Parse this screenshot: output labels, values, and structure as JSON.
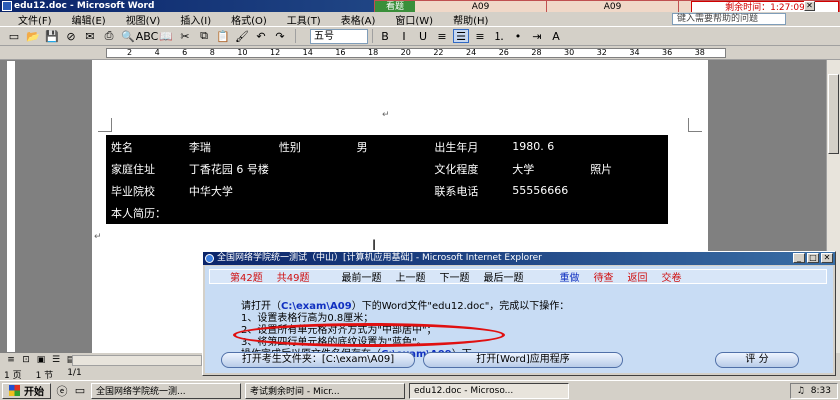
{
  "window": {
    "title": "edu12.doc - Microsoft Word",
    "controls": [
      "_",
      "□",
      "✕"
    ]
  },
  "exam_strip": {
    "seen_label": "看题",
    "cell1": "A09",
    "cell2": "A09",
    "timer": "剩余时间：1:27:09"
  },
  "menu": {
    "items": [
      "文件(F)",
      "编辑(E)",
      "视图(V)",
      "插入(I)",
      "格式(O)",
      "工具(T)",
      "表格(A)",
      "窗口(W)",
      "帮助(H)"
    ],
    "help_box": "键入需要帮助的问题"
  },
  "toolbar": {
    "icons": [
      {
        "name": "new-doc-icon",
        "glyph": "▭"
      },
      {
        "name": "open-icon",
        "glyph": "📂"
      },
      {
        "name": "save-icon",
        "glyph": "💾"
      },
      {
        "name": "permission-icon",
        "glyph": "⊘"
      },
      {
        "name": "email-icon",
        "glyph": "✉"
      },
      {
        "name": "print-icon",
        "glyph": "⎙"
      },
      {
        "name": "preview-icon",
        "glyph": "🔍"
      },
      {
        "name": "spell-icon",
        "glyph": "ABC"
      },
      {
        "name": "research-icon",
        "glyph": "📖"
      },
      {
        "name": "cut-icon",
        "glyph": "✂"
      },
      {
        "name": "copy-icon",
        "glyph": "⧉"
      },
      {
        "name": "paste-icon",
        "glyph": "📋"
      },
      {
        "name": "format-painter-icon",
        "glyph": "🖌"
      },
      {
        "name": "undo-icon",
        "glyph": "↶"
      },
      {
        "name": "redo-icon",
        "glyph": "↷"
      }
    ],
    "font_size": "五号",
    "format_icons": [
      {
        "name": "bold-icon",
        "glyph": "B"
      },
      {
        "name": "italic-icon",
        "glyph": "I"
      },
      {
        "name": "underline-icon",
        "glyph": "U"
      },
      {
        "name": "align-left-icon",
        "glyph": "≡"
      },
      {
        "name": "align-center-icon",
        "glyph": "☰",
        "selected": true
      },
      {
        "name": "align-right-icon",
        "glyph": "≡"
      },
      {
        "name": "numbering-icon",
        "glyph": "⒈"
      },
      {
        "name": "bullets-icon",
        "glyph": "•"
      },
      {
        "name": "indent-icon",
        "glyph": "⇥"
      },
      {
        "name": "font-color-icon",
        "glyph": "A"
      }
    ]
  },
  "ruler": {
    "ticks": [
      "2",
      "4",
      "6",
      "8",
      "10",
      "12",
      "14",
      "16",
      "18",
      "20",
      "22",
      "24",
      "26",
      "28",
      "30",
      "32",
      "34",
      "36",
      "38"
    ]
  },
  "document": {
    "para_mark": "↵",
    "table": [
      [
        {
          "text": "姓名",
          "style": "blk"
        },
        {
          "text": "李瑞",
          "style": "blk"
        },
        {
          "text": "性别",
          "style": "blk"
        },
        {
          "text": "男",
          "style": "blk"
        },
        {
          "text": "出生年月",
          "style": "blk"
        },
        {
          "text": "1980. 6",
          "style": "blk"
        },
        {
          "text": "照片",
          "style": "blk"
        }
      ],
      [
        {
          "text": "家庭住址",
          "style": "blk"
        },
        {
          "text": "丁香花园 6 号楼",
          "style": "blk"
        },
        {
          "text": "",
          "style": "blk"
        },
        {
          "text": "",
          "style": "blk"
        },
        {
          "text": "文化程度",
          "style": "blk"
        },
        {
          "text": "大学",
          "style": "blk"
        },
        {
          "text": "",
          "style": "wht"
        }
      ],
      [
        {
          "text": "毕业院校",
          "style": "blk"
        },
        {
          "text": "中华大学",
          "style": "blk"
        },
        {
          "text": "",
          "style": "blk"
        },
        {
          "text": "",
          "style": "blk"
        },
        {
          "text": "联系电话",
          "style": "blk"
        },
        {
          "text": "55556666",
          "style": "blk"
        },
        {
          "text": "",
          "style": "wht"
        }
      ],
      [
        {
          "text": "本人简历：",
          "style": "blk"
        }
      ]
    ]
  },
  "statusbar": {
    "page": "1 页",
    "section": "1 节",
    "of": "1/1"
  },
  "dialog": {
    "title": "全国网络学院统一测试（中山）[计算机应用基础] - Microsoft Internet Explorer",
    "question_no": "第42题",
    "total": "共49题",
    "nav": [
      {
        "label": "最前一题",
        "color": "black"
      },
      {
        "label": "上一题",
        "color": "black"
      },
      {
        "label": "下一题",
        "color": "black"
      },
      {
        "label": "最后一题",
        "color": "black"
      },
      {
        "label": "重做",
        "color": "blue"
      },
      {
        "label": "待查",
        "color": "red"
      },
      {
        "label": "返回",
        "color": "red"
      },
      {
        "label": "交卷",
        "color": "red"
      }
    ],
    "instruction_lead": "请打开（",
    "instruction_path": "C:\\exam\\A09",
    "instruction_rest": "）下的Word文件\"edu12.doc\"，完成以下操作：",
    "steps": [
      "1、设置表格行高为0.8厘米；",
      "2、设置所有单元格对齐方式为\"中部居中\"；",
      "3、将第四行单元格的底纹设置为\"蓝色\"。"
    ],
    "save_lead": "操作完成后以原文件名保存在（",
    "save_path": "C:\\exam\\A09",
    "save_tail": "）下。",
    "btn_open_folder": "打开考生文件夹：[C:\\exam\\A09]",
    "btn_open_word": "打开[Word]应用程序",
    "btn_score": "评  分"
  },
  "taskbar": {
    "start": "开始",
    "tasks": [
      {
        "label": "全国网络学院统一测...",
        "active": false
      },
      {
        "label": "考试剩余时间 - Micr...",
        "active": false
      },
      {
        "label": "edu12.doc - Microso...",
        "active": true
      }
    ],
    "clock": "8:33"
  }
}
